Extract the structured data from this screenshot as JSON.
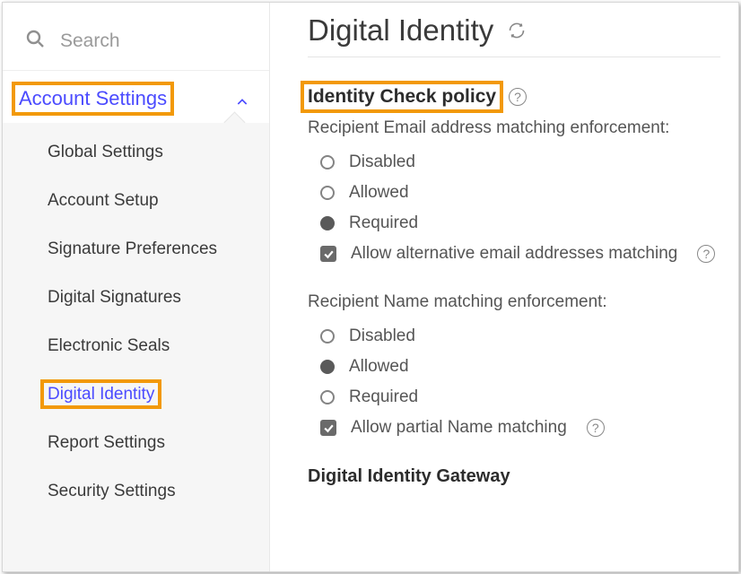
{
  "sidebar": {
    "search_placeholder": "Search",
    "section_label": "Account Settings",
    "items": [
      {
        "label": "Global Settings",
        "selected": false
      },
      {
        "label": "Account Setup",
        "selected": false
      },
      {
        "label": "Signature Preferences",
        "selected": false
      },
      {
        "label": "Digital Signatures",
        "selected": false
      },
      {
        "label": "Electronic Seals",
        "selected": false
      },
      {
        "label": "Digital Identity",
        "selected": true
      },
      {
        "label": "Report Settings",
        "selected": false
      },
      {
        "label": "Security Settings",
        "selected": false
      }
    ]
  },
  "page": {
    "title": "Digital Identity",
    "section_title": "Identity Check policy",
    "group1": {
      "label": "Recipient Email address matching enforcement:",
      "options": [
        {
          "label": "Disabled",
          "selected": false
        },
        {
          "label": "Allowed",
          "selected": false
        },
        {
          "label": "Required",
          "selected": true
        }
      ],
      "checkbox_label": "Allow alternative email addresses matching",
      "checkbox_checked": true
    },
    "group2": {
      "label": "Recipient Name matching enforcement:",
      "options": [
        {
          "label": "Disabled",
          "selected": false
        },
        {
          "label": "Allowed",
          "selected": true
        },
        {
          "label": "Required",
          "selected": false
        }
      ],
      "checkbox_label": "Allow partial Name matching",
      "checkbox_checked": true
    },
    "gateway_title": "Digital Identity Gateway"
  }
}
